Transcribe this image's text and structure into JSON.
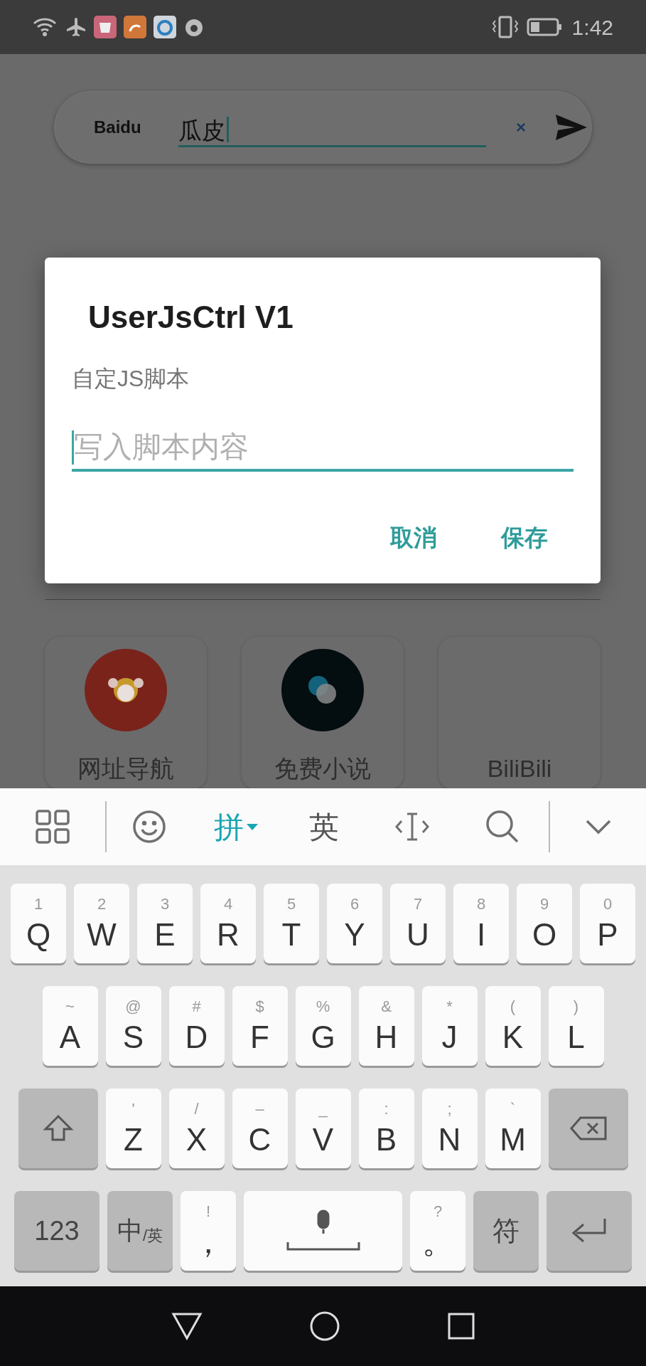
{
  "status_bar": {
    "time": "1:42"
  },
  "search_bar": {
    "engine": "Baidu",
    "value": "瓜皮",
    "clear": "×"
  },
  "dialog": {
    "title": "UserJsCtrl V1",
    "subtitle": "自定JS脚本",
    "input": {
      "placeholder": "写入脚本内容"
    },
    "buttons": [
      "取消",
      "保存"
    ]
  },
  "shortcuts": [
    {
      "label": "网址导航",
      "kind": "avatar"
    },
    {
      "label": "免费小说",
      "kind": "dots"
    },
    {
      "label": "BiliBili",
      "kind": "blank"
    }
  ],
  "keyboard": {
    "input_modes": [
      {
        "label": "拼",
        "selected": true
      },
      {
        "label": "英",
        "selected": false
      }
    ],
    "rows": [
      {
        "keys": [
          {
            "kind": "key",
            "hint": "1",
            "label": "Q"
          },
          {
            "kind": "key",
            "hint": "2",
            "label": "W"
          },
          {
            "kind": "key",
            "hint": "3",
            "label": "E"
          },
          {
            "kind": "key",
            "hint": "4",
            "label": "R"
          },
          {
            "kind": "key",
            "hint": "5",
            "label": "T"
          },
          {
            "kind": "key",
            "hint": "6",
            "label": "Y"
          },
          {
            "kind": "key",
            "hint": "7",
            "label": "U"
          },
          {
            "kind": "key",
            "hint": "8",
            "label": "I"
          },
          {
            "kind": "key",
            "hint": "9",
            "label": "O"
          },
          {
            "kind": "key",
            "hint": "0",
            "label": "P"
          }
        ]
      },
      {
        "keys": [
          {
            "kind": "key",
            "hint": "~",
            "label": "A"
          },
          {
            "kind": "key",
            "hint": "@",
            "label": "S"
          },
          {
            "kind": "key",
            "hint": "#",
            "label": "D"
          },
          {
            "kind": "key",
            "hint": "$",
            "label": "F"
          },
          {
            "kind": "key",
            "hint": "%",
            "label": "G"
          },
          {
            "kind": "key",
            "hint": "&",
            "label": "H"
          },
          {
            "kind": "key",
            "hint": "*",
            "label": "J"
          },
          {
            "kind": "key",
            "hint": "(",
            "label": "K"
          },
          {
            "kind": "key",
            "hint": ")",
            "label": "L"
          }
        ]
      },
      {
        "keys": [
          {
            "kind": "shift"
          },
          {
            "kind": "key",
            "hint": "'",
            "label": "Z"
          },
          {
            "kind": "key",
            "hint": "/",
            "label": "X"
          },
          {
            "kind": "key",
            "hint": "–",
            "label": "C"
          },
          {
            "kind": "key",
            "hint": "_",
            "label": "V"
          },
          {
            "kind": "key",
            "hint": ":",
            "label": "B"
          },
          {
            "kind": "key",
            "hint": ";",
            "label": "N"
          },
          {
            "kind": "key",
            "hint": "`",
            "label": "M"
          },
          {
            "kind": "backspace"
          }
        ]
      },
      {
        "keys": [
          {
            "kind": "func",
            "label": "123"
          },
          {
            "kind": "lang",
            "label": "中",
            "sub": "/英"
          },
          {
            "kind": "key",
            "hint": "!",
            "label": "，"
          },
          {
            "kind": "space"
          },
          {
            "kind": "key",
            "hint": "?",
            "label": "。"
          },
          {
            "kind": "func",
            "label": "符"
          },
          {
            "kind": "enter"
          }
        ]
      }
    ]
  }
}
